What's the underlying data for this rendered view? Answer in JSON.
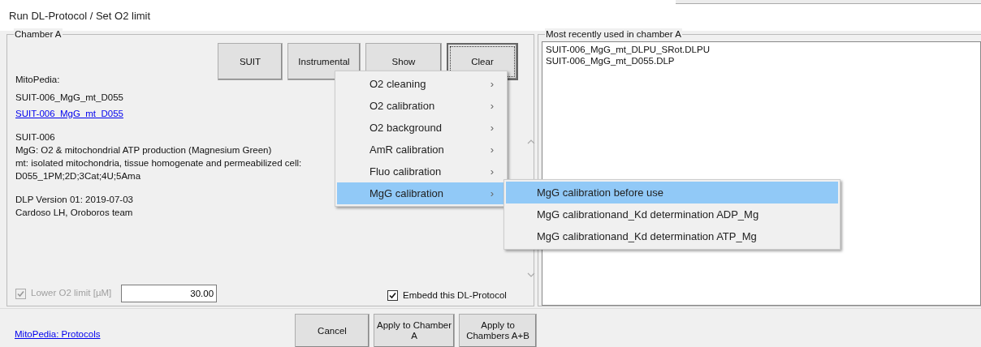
{
  "window": {
    "title": "Run DL-Protocol / Set O2 limit"
  },
  "chamber_panel": {
    "title": "Chamber A",
    "buttons": [
      {
        "label": "SUIT",
        "focused": false
      },
      {
        "label": "Instrumental",
        "focused": false
      },
      {
        "label": "Show",
        "focused": false
      },
      {
        "label": "Clear",
        "focused": true
      }
    ],
    "mitopedia_label": "MitoPedia:",
    "protocol_name": "SUIT-006_MgG_mt_D055",
    "protocol_link": "SUIT-006_MgG_mt_D055",
    "description_lines": [
      "SUIT-006",
      "MgG: O2 & mitochondrial ATP production (Magnesium Green)",
      "mt: isolated mitochondria, tissue homogenate and permeabilized cell:",
      "D055_1PM;2D;3Cat;4U;5Ama"
    ],
    "version_lines": [
      "DLP Version 01:  2019-07-03",
      "Cardoso LH, Oroboros team"
    ],
    "lower_limit": {
      "label": "Lower O2 limit [µM]",
      "checked": true,
      "disabled": true,
      "value": "30.00"
    },
    "embed": {
      "label": "Embedd this DL-Protocol",
      "checked": true,
      "disabled": false
    }
  },
  "recent_panel": {
    "title": "Most recently used in chamber A",
    "items": [
      "SUIT-006_MgG_mt_DLPU_SRot.DLPU",
      "SUIT-006_MgG_mt_D055.DLP"
    ]
  },
  "context_menu": {
    "items": [
      {
        "label": "O2 cleaning",
        "selected": false
      },
      {
        "label": "O2 calibration",
        "selected": false
      },
      {
        "label": "O2 background",
        "selected": false
      },
      {
        "label": "AmR calibration",
        "selected": false
      },
      {
        "label": "Fluo calibration",
        "selected": false
      },
      {
        "label": "MgG calibration",
        "selected": true,
        "submenu": [
          {
            "label": "MgG calibration before use",
            "selected": true
          },
          {
            "label": "MgG calibrationand_Kd determination ADP_Mg",
            "selected": false
          },
          {
            "label": "MgG calibrationand_Kd determination ATP_Mg",
            "selected": false
          }
        ]
      }
    ]
  },
  "arrow_glyph": "›",
  "footer": {
    "link": "MitoPedia: Protocols",
    "buttons": [
      {
        "label": "Cancel"
      },
      {
        "label": "Apply to Chamber A"
      },
      {
        "label": "Apply to Chambers A+B"
      }
    ]
  }
}
